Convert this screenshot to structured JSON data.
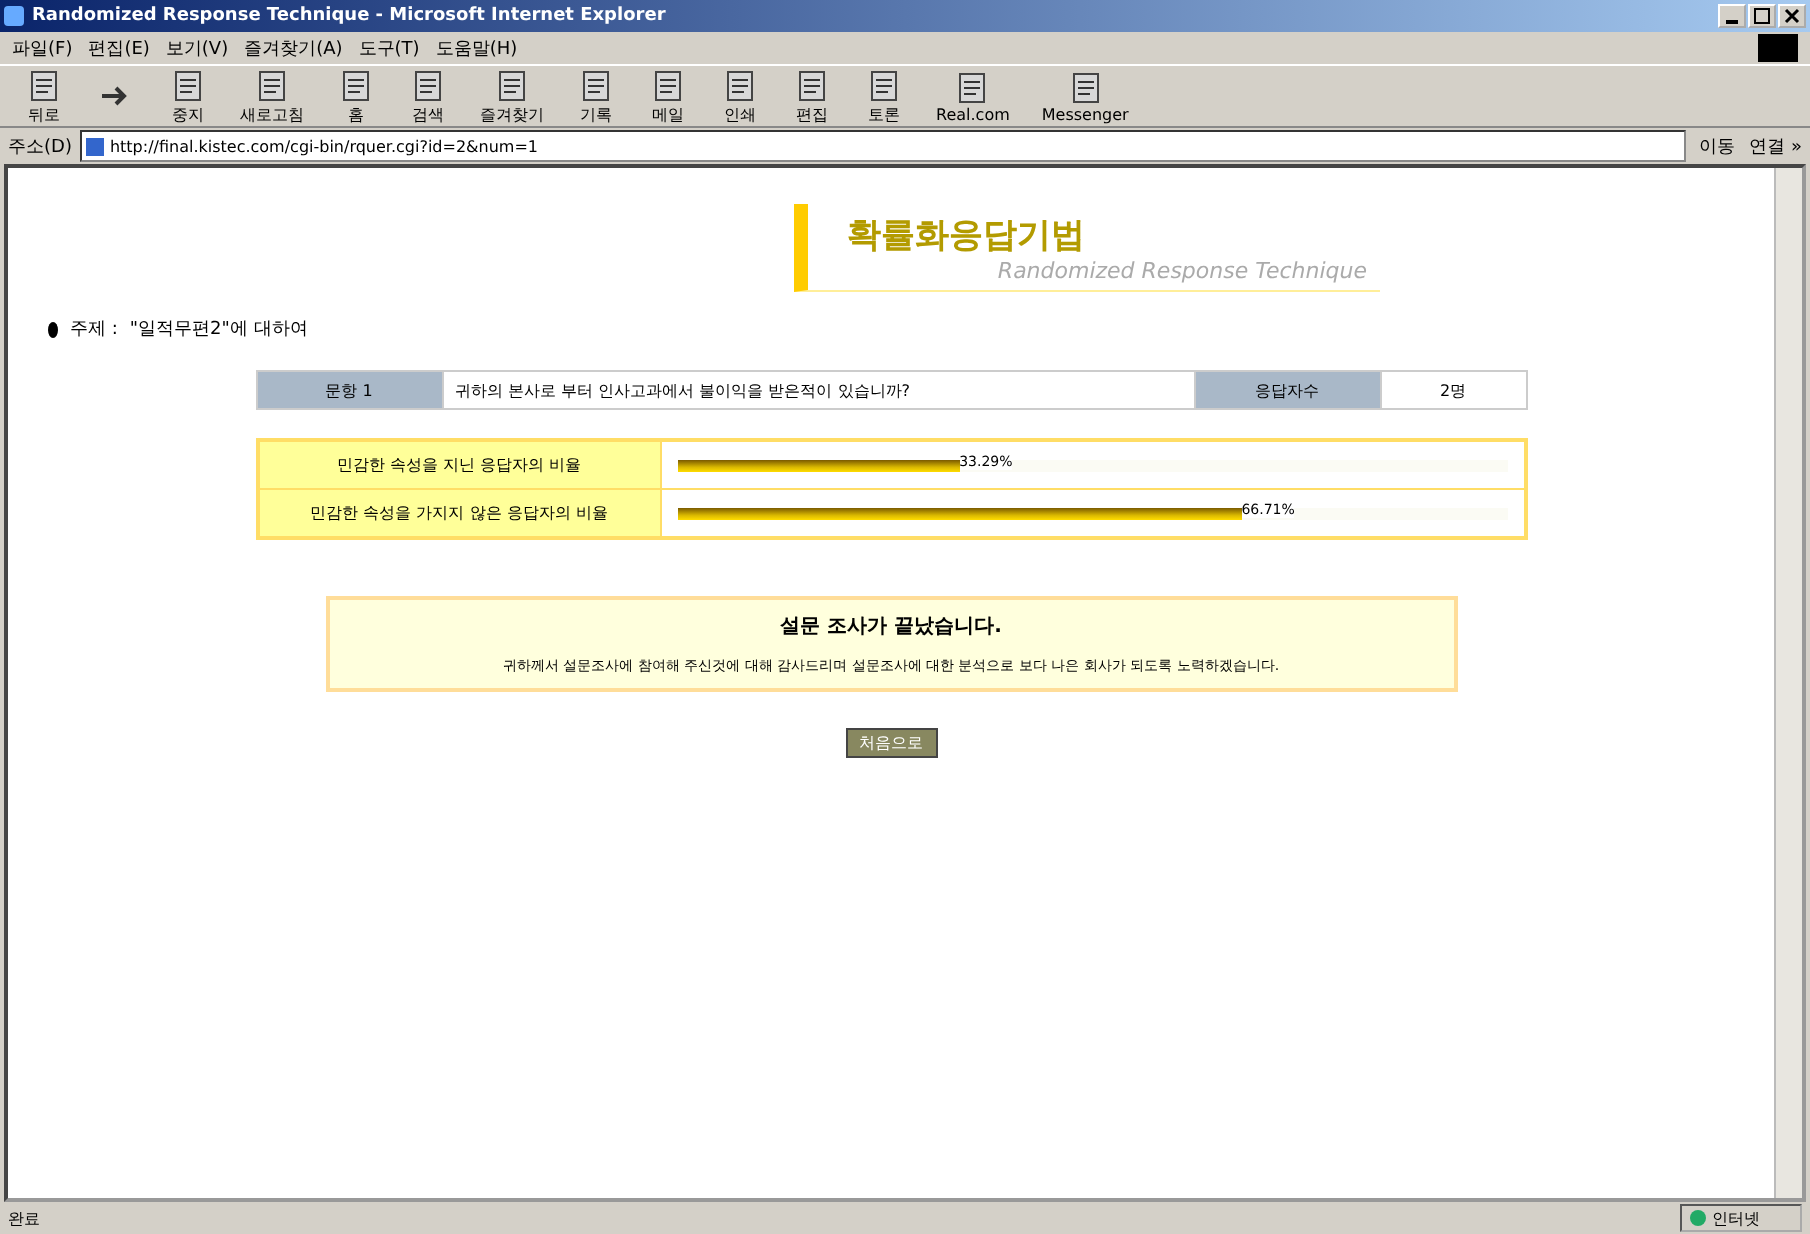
{
  "window": {
    "title": "Randomized Response Technique - Microsoft Internet Explorer"
  },
  "menu": [
    "파일(F)",
    "편집(E)",
    "보기(V)",
    "즐겨찾기(A)",
    "도구(T)",
    "도움말(H)"
  ],
  "toolbar": [
    {
      "kind": "page",
      "label": "뒤로"
    },
    {
      "kind": "arrow"
    },
    {
      "kind": "page",
      "label": "중지"
    },
    {
      "kind": "page",
      "label": "새로고침"
    },
    {
      "kind": "page",
      "label": "홈"
    },
    {
      "kind": "page",
      "label": "검색"
    },
    {
      "kind": "page",
      "label": "즐겨찾기"
    },
    {
      "kind": "page",
      "label": "기록"
    },
    {
      "kind": "page",
      "label": "메일"
    },
    {
      "kind": "page",
      "label": "인쇄"
    },
    {
      "kind": "page",
      "label": "편집"
    },
    {
      "kind": "page",
      "label": "토론"
    },
    {
      "kind": "page",
      "label": "Real.com"
    },
    {
      "kind": "page",
      "label": "Messenger"
    }
  ],
  "address": {
    "label": "주소(D)",
    "value": "http://final.kistec.com/cgi-bin/rquer.cgi?id=2&num=1",
    "go": "이동",
    "links": "연결 »"
  },
  "page": {
    "title": "확률화응답기법",
    "subtitle": "Randomized Response Technique",
    "topic_label": "주제 :",
    "topic": "\"일적무편2\"에 대하여",
    "question": {
      "label": "문항 1",
      "text": "귀하의 본사로 부터 인사고과에서 불이익을 받은적이 있습니까?",
      "count_label": "응답자수",
      "count": "2명"
    },
    "results": [
      {
        "label": "민감한 속성을 지닌 응답자의 비율",
        "level": 0.34,
        "reading": "33.29%"
      },
      {
        "label": "민감한 속성을 가지지 않은 응답자의 비율",
        "level": 0.68,
        "reading": "66.71%"
      }
    ],
    "notice": {
      "title": "설문 조사가 끝났습니다.",
      "text": "귀하께서 설문조사에 참여해 주신것에 대해 감사드리며 설문조사에 대한 분석으로 보다 나은 회사가 되도록 노력하겠습니다."
    },
    "button": "처음으로"
  },
  "status_bar": {
    "text": "완료",
    "zone": "인터넷"
  }
}
